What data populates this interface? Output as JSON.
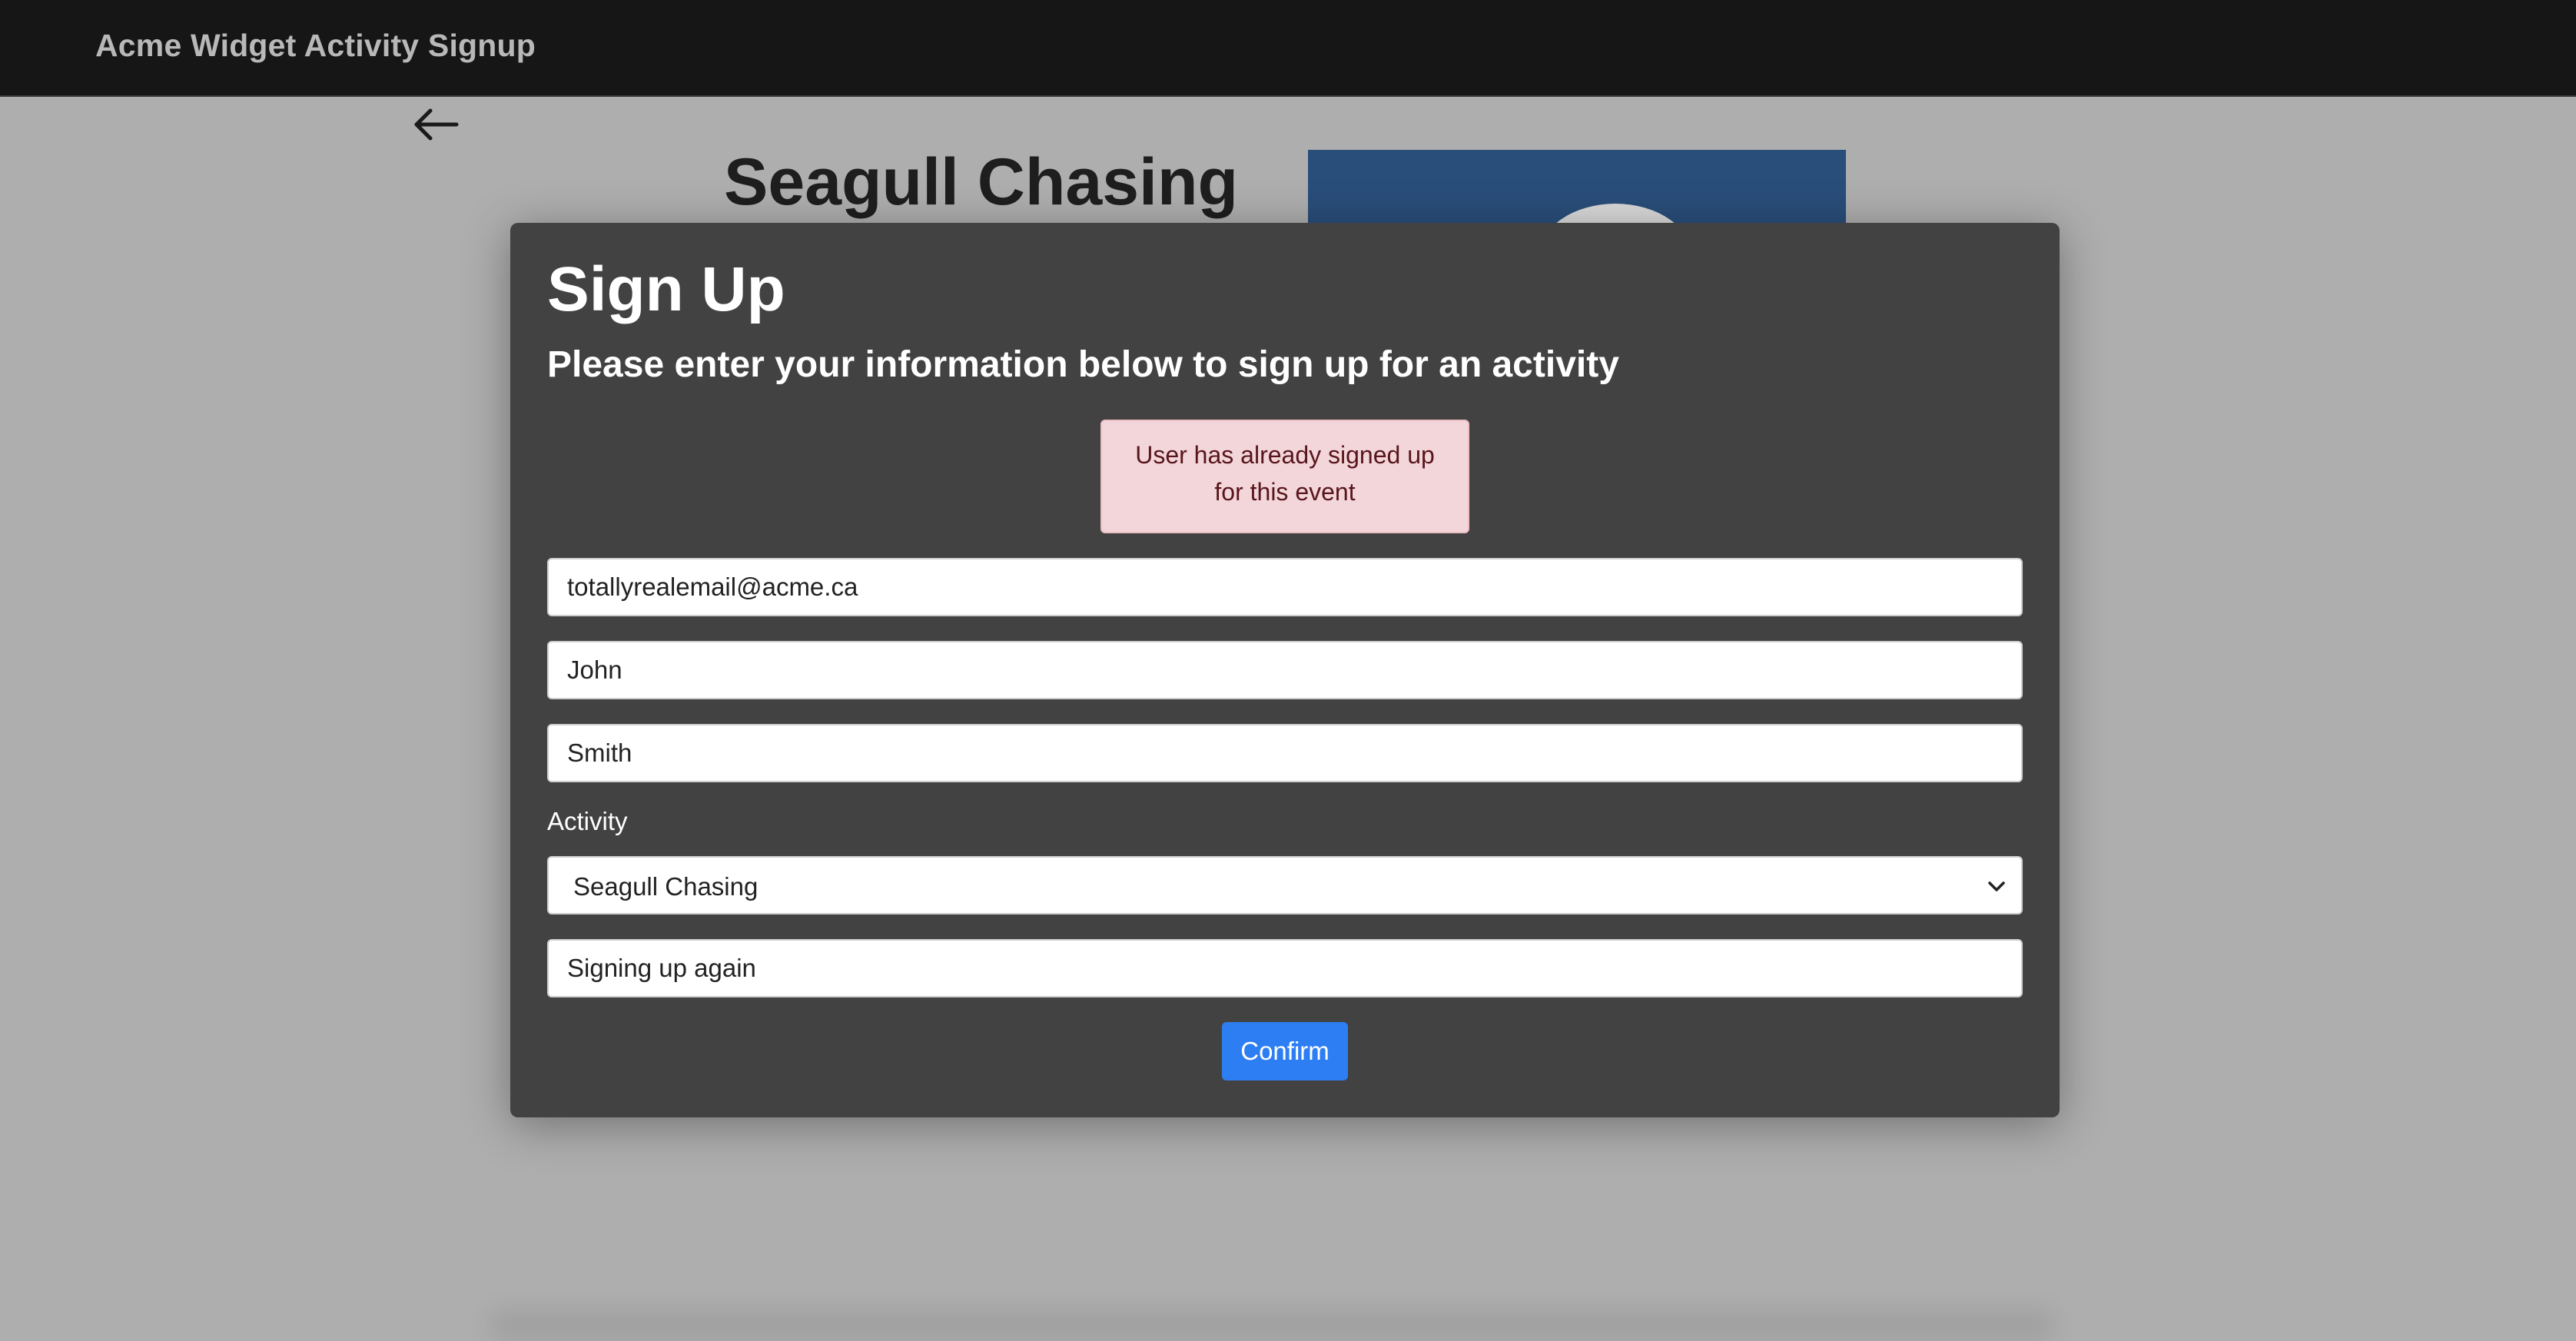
{
  "navbar": {
    "brand": "Acme Widget Activity Signup"
  },
  "page": {
    "back_icon": "arrow-left-icon",
    "title": "Seagull Chasing",
    "image_color": "#294e7a"
  },
  "modal": {
    "title": "Sign Up",
    "subtitle": "Please enter your information below to sign up for an activity",
    "alert": {
      "line1": "User has already signed up",
      "line2": "for this event",
      "color": "#f2d6d9"
    },
    "fields": {
      "email": "totallyrealemail@acme.ca",
      "first_name": "John",
      "last_name": "Smith",
      "comment": "Signing up again"
    },
    "activity": {
      "label": "Activity",
      "selected": "Seagull Chasing",
      "icon": "chevron-down-icon"
    },
    "confirm_label": "Confirm",
    "confirm_color": "#2d7ef3"
  }
}
